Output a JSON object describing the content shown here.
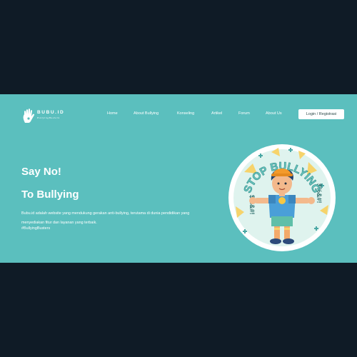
{
  "brand": {
    "name": "BUBU.ID",
    "tagline": "BullyingBusters"
  },
  "nav": {
    "items": [
      {
        "label": "Home"
      },
      {
        "label": "About Bullying"
      },
      {
        "label": "Konseling"
      },
      {
        "label": "Artikel"
      },
      {
        "label": "Forum"
      },
      {
        "label": "About Us"
      }
    ],
    "login_label": "Login / Registrasi"
  },
  "hero": {
    "line1": "Say No!",
    "line2": "To Bullying",
    "description": "Bubu.id adalah website yang mendukung gerakan anti-bullying, terutama di dunia pendidikan yang menyediakan fitur dan layanan yang terbaik.",
    "hashtag": "#BullyingBusters"
  },
  "illustration": {
    "badge_text": "STOP BULLYING",
    "symbols": "$%&#!",
    "icon": "stop-bullying-badge-icon"
  },
  "colors": {
    "page_background": "#0f1b26",
    "hero_background": "#5bbfbe",
    "text": "#ffffff",
    "button_background": "#ffffff"
  }
}
